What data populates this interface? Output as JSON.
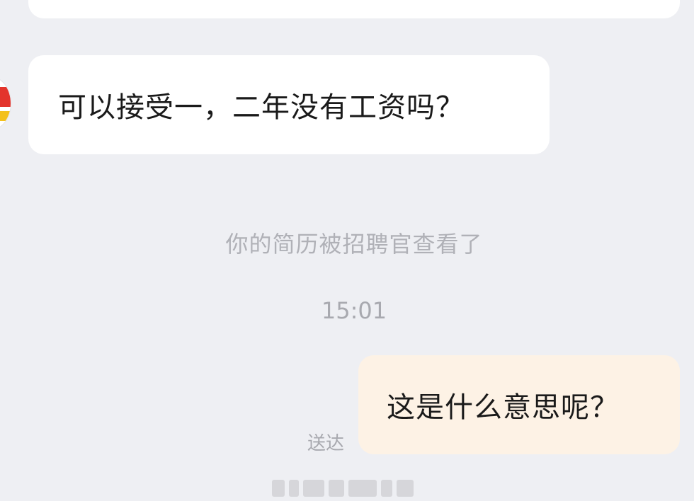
{
  "chat": {
    "incoming_message": "可以接受一，二年没有工资吗？",
    "system_notice": "你的简历被招聘官查看了",
    "timestamp": "15:01",
    "outgoing_message": "这是什么意思呢？",
    "delivery_status": "送达"
  },
  "colors": {
    "background": "#eeeff3",
    "incoming_bubble": "#ffffff",
    "outgoing_bubble": "#fdf2e5",
    "muted_text": "#b0b1b7"
  }
}
